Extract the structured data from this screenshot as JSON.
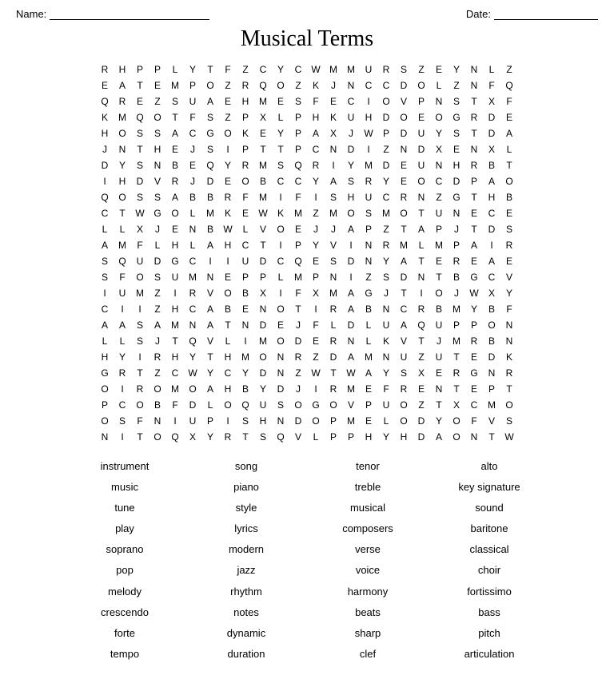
{
  "header": {
    "name_label": "Name:",
    "date_label": "Date:"
  },
  "title": "Musical Terms",
  "grid": [
    "R H P P L Y T F Z C Y C W M M U R S Z E Y N L Z",
    "E A T E M P O Z R Q O Z K J N C C D O L Z N F Q",
    "Q R E Z S U A E H M E S F E C I O V P N S T X F",
    "K M Q O T F S Z P X L P H K U H D O E O G R D E",
    "H O S S A C G O K E Y P A X J W P D U Y S T D A",
    "J N T H E J S I P T T P C N D I Z N D X E N X L",
    "D Y S N B E Q Y R M S Q R I Y M D E U N H R B T",
    "I H D V R J D E O B C C Y A S R Y E O C D P A O",
    "Q O S S A B B R F M I F I S H U C R N Z G T H B",
    "C T W G O L M K E W K M Z M O S M O T U N E C E",
    "L L X J E N B W L V O E J J A P Z T A P J T D S",
    "A M F L H L A H C T I P Y V I N R M L M P A I R",
    "S Q U D G C I I U D C Q E S D N Y A T E R E A E",
    "S F O S U M N E P P L M P N I Z S D N T B G C V",
    "I U M Z I R V O B X I F X M A G J T I O J W X Y",
    "C I I Z H C A B E N O T I R A B N C R B M Y B F",
    "A A S A M N A T N D E J F L D L U A Q U P P O N",
    "L L S J T Q V L I M O D E R N L K V T J M R B N",
    "H Y I R H Y T H M O N R Z D A M N U Z U T E D K",
    "G R T Z C W Y C Y D N Z W T W A Y S X E R G N R",
    "O I R O M O A H B Y D J I R M E F R E N T E P T",
    "P C O B F D L O Q U S O G O V P U O Z T X C M O",
    "O S F N I U P I S H N D O P M E L O D Y O F V S",
    "N I T O Q X Y R T S Q V L P P H Y H D A O N T W"
  ],
  "words": [
    "instrument",
    "song",
    "tenor",
    "alto",
    "music",
    "piano",
    "treble",
    "key signature",
    "tune",
    "style",
    "musical",
    "sound",
    "play",
    "lyrics",
    "composers",
    "baritone",
    "soprano",
    "modern",
    "verse",
    "classical",
    "pop",
    "jazz",
    "voice",
    "choir",
    "melody",
    "rhythm",
    "harmony",
    "fortissimo",
    "crescendo",
    "notes",
    "beats",
    "bass",
    "forte",
    "dynamic",
    "sharp",
    "pitch",
    "tempo",
    "duration",
    "clef",
    "articulation"
  ]
}
